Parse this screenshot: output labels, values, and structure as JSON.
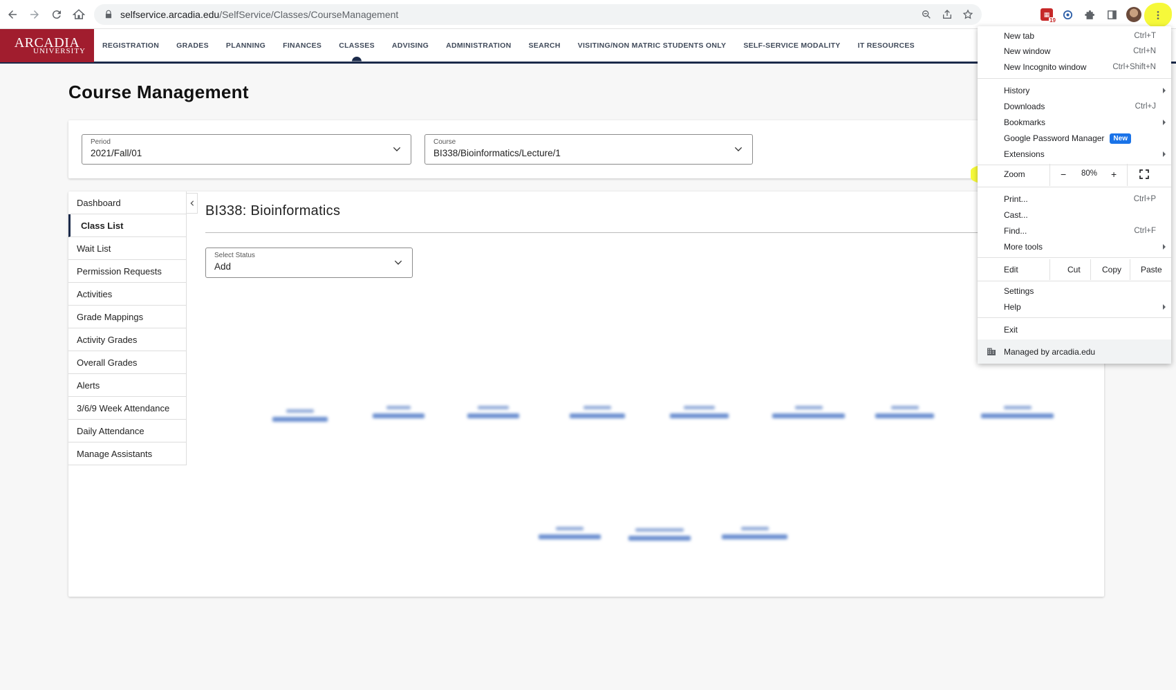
{
  "browser": {
    "url_host": "selfservice.arcadia.edu",
    "url_path": "/SelfService/Classes/CourseManagement",
    "calendar_badge": "19"
  },
  "logo": {
    "line1": "ARCADIA",
    "line2": "UNIVERSITY"
  },
  "topnav": [
    "REGISTRATION",
    "GRADES",
    "PLANNING",
    "FINANCES",
    "CLASSES",
    "ADVISING",
    "ADMINISTRATION",
    "SEARCH",
    "VISITING/NON MATRIC STUDENTS ONLY",
    "SELF-SERVICE MODALITY",
    "IT RESOURCES"
  ],
  "page": {
    "title": "Course Management",
    "period": {
      "label": "Period",
      "value": "2021/Fall/01"
    },
    "course": {
      "label": "Course",
      "value": "BI338/Bioinformatics/Lecture/1"
    },
    "course_heading": "BI338: Bioinformatics",
    "status": {
      "label": "Select Status",
      "value": "Add"
    }
  },
  "sidemenu": [
    "Dashboard",
    "Class List",
    "Wait List",
    "Permission Requests",
    "Activities",
    "Grade Mappings",
    "Activity Grades",
    "Overall Grades",
    "Alerts",
    "3/6/9 Week Attendance",
    "Daily Attendance",
    "Manage Assistants"
  ],
  "chrome_menu": {
    "new_tab": "New tab",
    "new_tab_sc": "Ctrl+T",
    "new_window": "New window",
    "new_window_sc": "Ctrl+N",
    "incognito": "New Incognito window",
    "incognito_sc": "Ctrl+Shift+N",
    "history": "History",
    "downloads": "Downloads",
    "downloads_sc": "Ctrl+J",
    "bookmarks": "Bookmarks",
    "password_manager": "Google Password Manager",
    "new_badge": "New",
    "extensions": "Extensions",
    "zoom": "Zoom",
    "zoom_minus": "−",
    "zoom_value": "80%",
    "zoom_plus": "+",
    "print": "Print...",
    "print_sc": "Ctrl+P",
    "cast": "Cast...",
    "find": "Find...",
    "find_sc": "Ctrl+F",
    "more_tools": "More tools",
    "edit": "Edit",
    "cut": "Cut",
    "copy": "Copy",
    "paste": "Paste",
    "settings": "Settings",
    "help": "Help",
    "exit": "Exit",
    "managed": "Managed by arcadia.edu"
  },
  "colors": {
    "brand_red": "#a11d2e",
    "navy": "#1b2a4a",
    "highlight": "#f6f93a",
    "chrome_blue": "#1a73e8"
  }
}
